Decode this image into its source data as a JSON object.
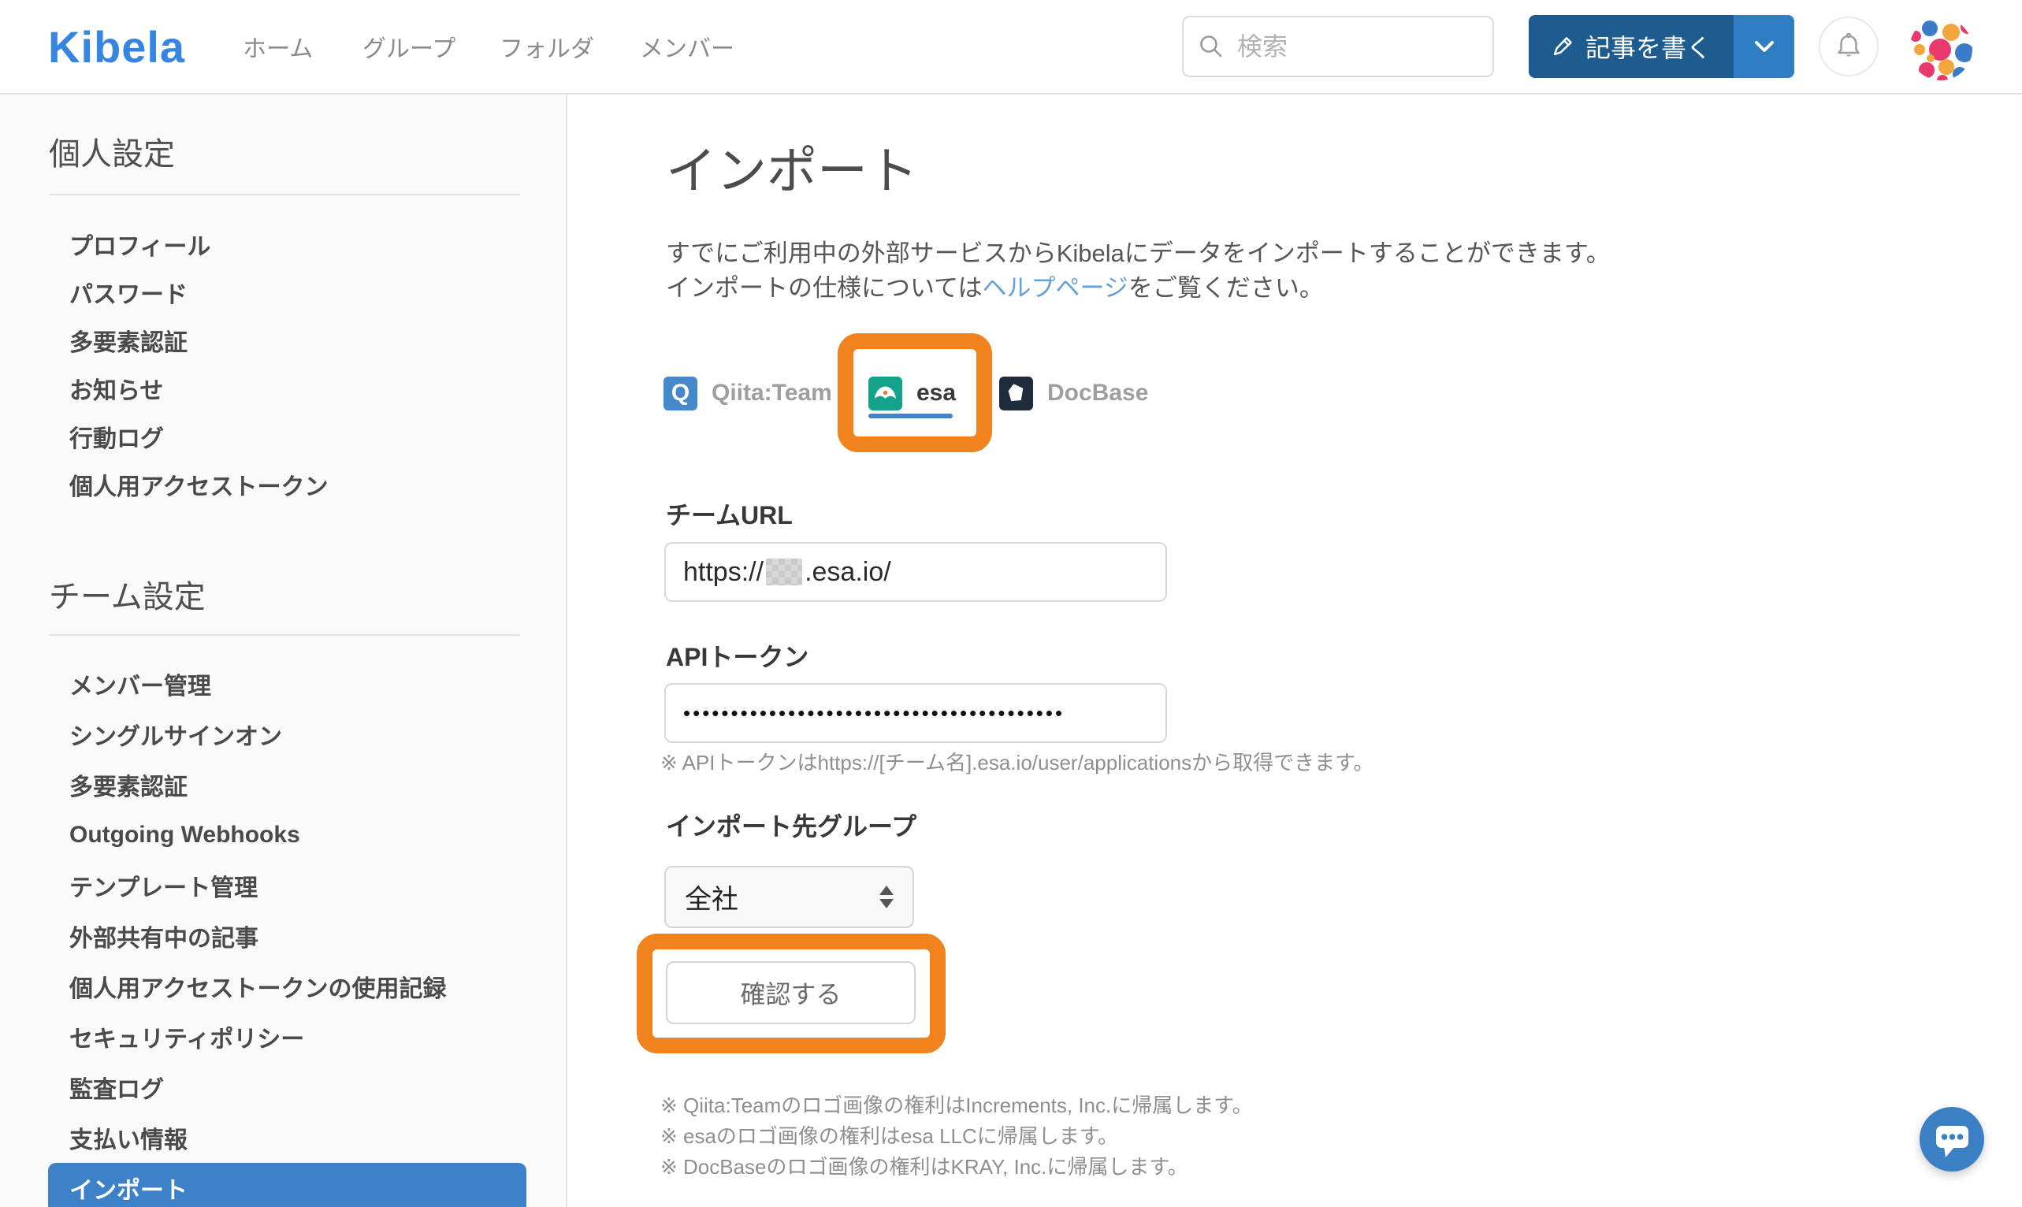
{
  "header": {
    "logo": "Kibela",
    "nav": {
      "home": "ホーム",
      "groups": "グループ",
      "folders": "フォルダ",
      "members": "メンバー"
    },
    "search": {
      "placeholder": "検索"
    },
    "write_button": {
      "label": "記事を書く"
    }
  },
  "sidebar": {
    "personal": {
      "title": "個人設定",
      "items": [
        "プロフィール",
        "パスワード",
        "多要素認証",
        "お知らせ",
        "行動ログ",
        "個人用アクセストークン"
      ]
    },
    "team": {
      "title": "チーム設定",
      "items": [
        "メンバー管理",
        "シングルサインオン",
        "多要素認証",
        "Outgoing Webhooks",
        "テンプレート管理",
        "外部共有中の記事",
        "個人用アクセストークンの使用記録",
        "セキュリティポリシー",
        "監査ログ",
        "支払い情報",
        "インポート"
      ],
      "active_item": "インポート"
    }
  },
  "main": {
    "title": "インポート",
    "intro_line1": "すでにご利用中の外部サービスからKibelaにデータをインポートすることができます。",
    "intro_line2_pre": "インポートの仕様については",
    "intro_link": "ヘルプページ",
    "intro_line2_post": "をご覧ください。",
    "tabs": {
      "qiita_label": "Qiita:Team",
      "qiita_icon_letter": "Q",
      "esa_label": "esa",
      "docbase_label": "DocBase",
      "active_tab": "esa"
    },
    "form": {
      "team_url_label": "チームURL",
      "team_url_prefix": "https://",
      "team_url_suffix": ".esa.io/",
      "api_token_label": "APIトークン",
      "api_token_masked": "••••••••••••••••••••••••••••••••••••••••",
      "api_token_note": "※ APIトークンはhttps://[チーム名].esa.io/user/applicationsから取得できます。",
      "group_label": "インポート先グループ",
      "group_value": "全社",
      "submit_label": "確認する"
    },
    "notes": [
      "※ Qiita:Teamのロゴ画像の権利はIncrements, Inc.に帰属します。",
      "※ esaのロゴ画像の権利はesa LLCに帰属します。",
      "※ DocBaseのロゴ画像の権利はKRAY, Inc.に帰属します。"
    ]
  },
  "colors": {
    "brand_blue": "#3585e2",
    "active_item_blue": "#3d82c8",
    "annotation_orange": "#f0831e",
    "link_blue": "#64a0dc",
    "esa_teal": "#14a28c",
    "qiita_blue": "#4589ca",
    "docbase_navy": "#1f2c3d",
    "write_button_blue": "#1e5c90",
    "tab_underline_blue": "#3f83c9"
  }
}
